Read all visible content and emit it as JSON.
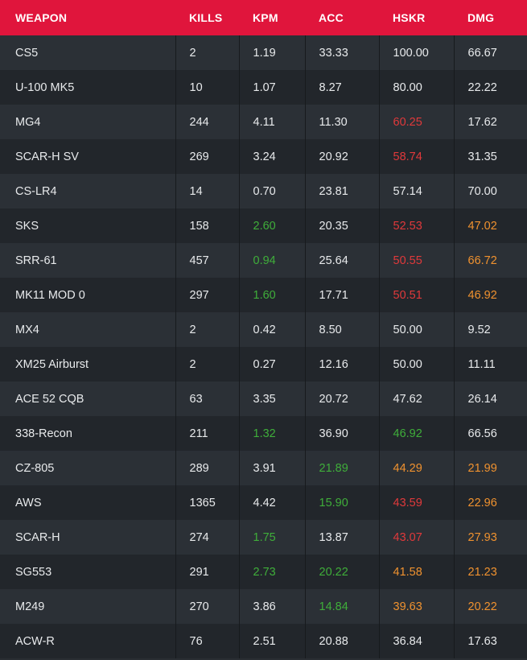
{
  "table": {
    "headers": [
      "WEAPON",
      "KILLS",
      "KPM",
      "ACC",
      "HSKR",
      "DMG"
    ],
    "rows": [
      {
        "weapon": "CS5",
        "kills": "2",
        "kpm": "1.19",
        "acc": "33.33",
        "hskr": "100.00",
        "dmg": "66.67"
      },
      {
        "weapon": "U-100 MK5",
        "kills": "10",
        "kpm": "1.07",
        "acc": "8.27",
        "hskr": "80.00",
        "dmg": "22.22"
      },
      {
        "weapon": "MG4",
        "kills": "244",
        "kpm": "4.11",
        "acc": "11.30",
        "hskr": "60.25",
        "dmg": "17.62"
      },
      {
        "weapon": "SCAR-H SV",
        "kills": "269",
        "kpm": "3.24",
        "acc": "20.92",
        "hskr": "58.74",
        "dmg": "31.35"
      },
      {
        "weapon": "CS-LR4",
        "kills": "14",
        "kpm": "0.70",
        "acc": "23.81",
        "hskr": "57.14",
        "dmg": "70.00"
      },
      {
        "weapon": "SKS",
        "kills": "158",
        "kpm": "2.60",
        "acc": "20.35",
        "hskr": "52.53",
        "dmg": "47.02"
      },
      {
        "weapon": "SRR-61",
        "kills": "457",
        "kpm": "0.94",
        "acc": "25.64",
        "hskr": "50.55",
        "dmg": "66.72"
      },
      {
        "weapon": "MK11 MOD 0",
        "kills": "297",
        "kpm": "1.60",
        "acc": "17.71",
        "hskr": "50.51",
        "dmg": "46.92"
      },
      {
        "weapon": "MX4",
        "kills": "2",
        "kpm": "0.42",
        "acc": "8.50",
        "hskr": "50.00",
        "dmg": "9.52"
      },
      {
        "weapon": "XM25 Airburst",
        "kills": "2",
        "kpm": "0.27",
        "acc": "12.16",
        "hskr": "50.00",
        "dmg": "11.11"
      },
      {
        "weapon": "ACE 52 CQB",
        "kills": "63",
        "kpm": "3.35",
        "acc": "20.72",
        "hskr": "47.62",
        "dmg": "26.14"
      },
      {
        "weapon": "338-Recon",
        "kills": "211",
        "kpm": "1.32",
        "acc": "36.90",
        "hskr": "46.92",
        "dmg": "66.56"
      },
      {
        "weapon": "CZ-805",
        "kills": "289",
        "kpm": "3.91",
        "acc": "21.89",
        "hskr": "44.29",
        "dmg": "21.99"
      },
      {
        "weapon": "AWS",
        "kills": "1365",
        "kpm": "4.42",
        "acc": "15.90",
        "hskr": "43.59",
        "dmg": "22.96"
      },
      {
        "weapon": "SCAR-H",
        "kills": "274",
        "kpm": "1.75",
        "acc": "13.87",
        "hskr": "43.07",
        "dmg": "27.93"
      },
      {
        "weapon": "SG553",
        "kills": "291",
        "kpm": "2.73",
        "acc": "20.22",
        "hskr": "41.58",
        "dmg": "21.23"
      },
      {
        "weapon": "M249",
        "kills": "270",
        "kpm": "3.86",
        "acc": "14.84",
        "hskr": "39.63",
        "dmg": "20.22"
      },
      {
        "weapon": "ACW-R",
        "kills": "76",
        "kpm": "2.51",
        "acc": "20.88",
        "hskr": "36.84",
        "dmg": "17.63"
      }
    ],
    "highlights": {
      "kpm": {
        "5": "green",
        "6": "green",
        "7": "green",
        "11": "green",
        "14": "green",
        "15": "green"
      },
      "acc": {
        "12": "green",
        "13": "green",
        "15": "green",
        "16": "green"
      },
      "hskr": {
        "2": "red",
        "3": "red",
        "5": "red",
        "6": "red",
        "7": "red",
        "11": "green",
        "12": "orange",
        "13": "red",
        "14": "red",
        "15": "orange",
        "16": "orange"
      },
      "dmg": {
        "5": "orange",
        "6": "orange",
        "7": "orange",
        "12": "orange",
        "13": "orange",
        "14": "orange",
        "15": "orange",
        "16": "orange"
      }
    }
  },
  "colors": {
    "header_bg": "#e0153c",
    "row_odd": "#2b3036",
    "row_even": "#22262b",
    "green": "#3fae3a",
    "red": "#e0393b",
    "orange": "#f0922f"
  }
}
